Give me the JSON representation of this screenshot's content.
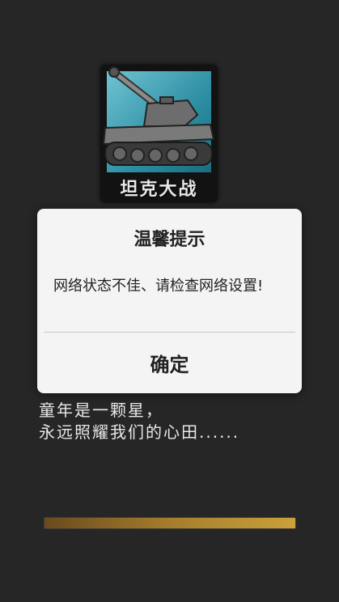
{
  "app_icon": {
    "title": "坦克大战"
  },
  "poem": {
    "line1": "童年是一颗星，",
    "line2": "永远照耀我们的心田......"
  },
  "progress": {
    "value": 1.0
  },
  "dialog": {
    "title": "温馨提示",
    "message": "网络状态不佳、请检查网络设置!",
    "confirm_label": "确定"
  }
}
